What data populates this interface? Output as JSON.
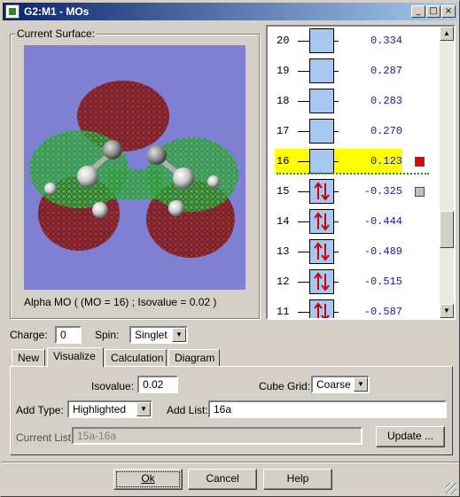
{
  "window": {
    "title": "G2:M1 - MOs"
  },
  "title_buttons": {
    "minimize": "_",
    "maximize": "□",
    "close": "×"
  },
  "surface": {
    "group_label": "Current Surface:",
    "caption": "Alpha MO ( (MO = 16) ; Isovalue = 0.02 )"
  },
  "mo_list": [
    {
      "num": "20",
      "energy": "0.334",
      "occupied": false
    },
    {
      "num": "19",
      "energy": "0.287",
      "occupied": false
    },
    {
      "num": "18",
      "energy": "0.283",
      "occupied": false
    },
    {
      "num": "17",
      "energy": "0.270",
      "occupied": false
    },
    {
      "num": "16",
      "energy": "0.123",
      "occupied": false,
      "highlighted": true,
      "marker_color": "#e00000"
    },
    {
      "num": "15",
      "energy": "-0.325",
      "occupied": true,
      "marker_color": "#c0c0c0"
    },
    {
      "num": "14",
      "energy": "-0.444",
      "occupied": true
    },
    {
      "num": "13",
      "energy": "-0.489",
      "occupied": true
    },
    {
      "num": "12",
      "energy": "-0.515",
      "occupied": true
    },
    {
      "num": "11",
      "energy": "-0.587",
      "occupied": true
    }
  ],
  "charge": {
    "label": "Charge:",
    "value": "0"
  },
  "spin": {
    "label": "Spin:",
    "value": "Singlet"
  },
  "tabs": [
    "New",
    "Visualize",
    "Calculation",
    "Diagram"
  ],
  "active_tab": "Visualize",
  "visualize": {
    "isovalue_label": "Isovalue:",
    "isovalue": "0.02",
    "cube_grid_label": "Cube Grid:",
    "cube_grid": "Coarse",
    "add_type_label": "Add Type:",
    "add_type": "Highlighted",
    "add_list_label": "Add List:",
    "add_list": "16a",
    "current_list_label": "Current List:",
    "current_list": "15a-16a",
    "update_button": "Update ..."
  },
  "footer": {
    "ok": "Ok",
    "cancel": "Cancel",
    "help": "Help"
  },
  "colors": {
    "title_start": "#0a246a",
    "title_end": "#a6caf0",
    "highlight": "#ffff00",
    "viewport_bg": "#7f7fd4",
    "orbital_red": "#8b1a1a",
    "orbital_green": "#2aa02a"
  }
}
